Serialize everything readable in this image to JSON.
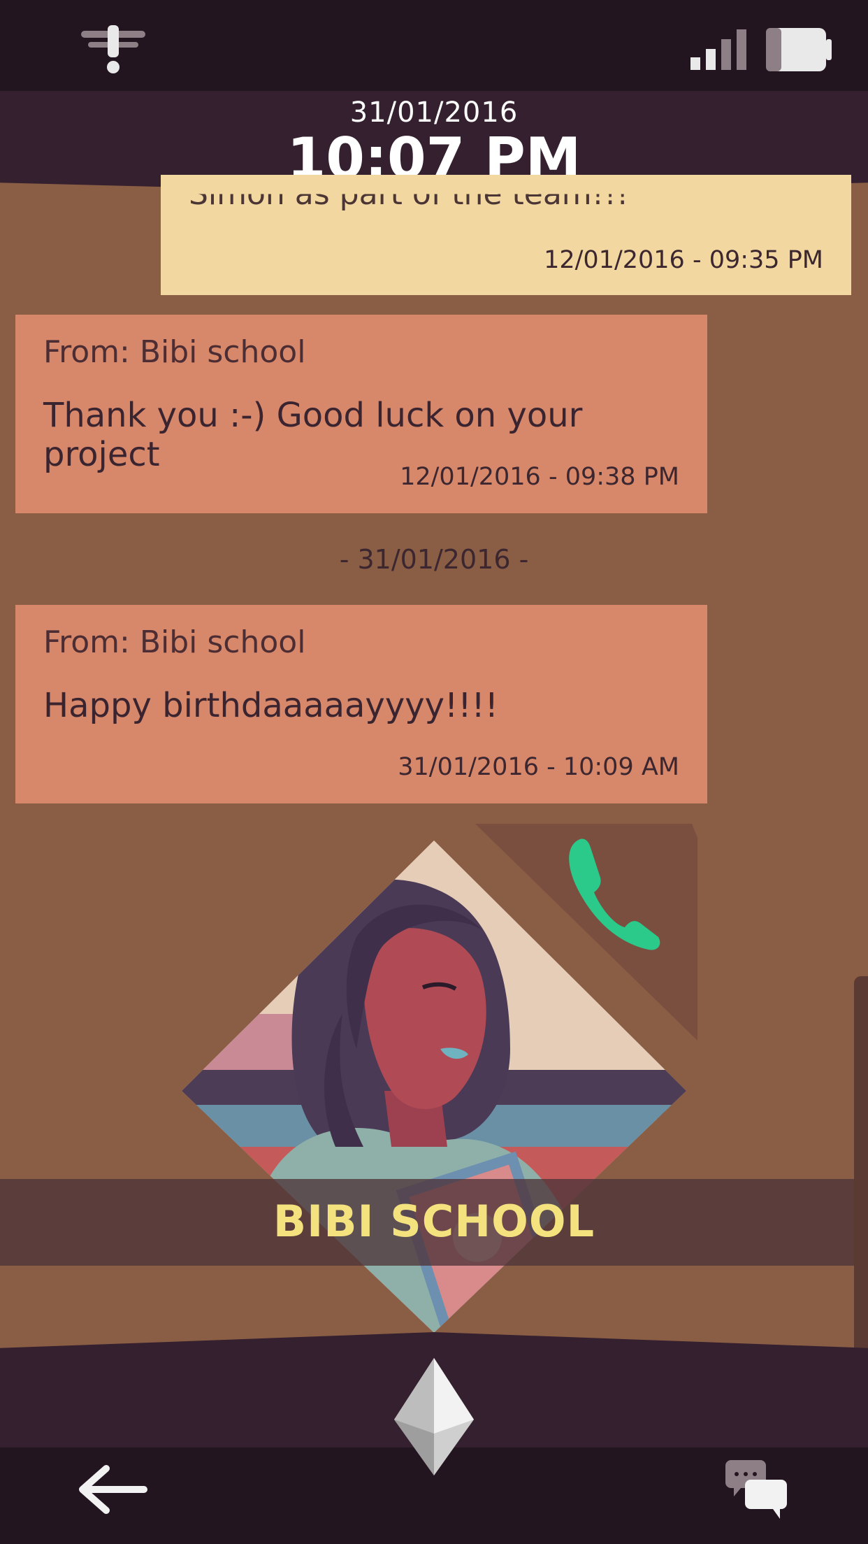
{
  "header": {
    "date": "31/01/2016",
    "time": "10:07 PM"
  },
  "status": {
    "notification_icon": "exclamation-icon",
    "signal_icon": "signal-bars-icon",
    "battery_icon": "battery-icon"
  },
  "conversation": {
    "previous_message": {
      "text_partial": "Simon as part of the team!!!",
      "timestamp": "12/01/2016 - 09:35 PM"
    },
    "messages": [
      {
        "from": "From: Bibi school",
        "text": "Thank you :-) Good luck on your project",
        "timestamp": "12/01/2016 - 09:38 PM"
      },
      {
        "from": "From: Bibi school",
        "text": "Happy birthdaaaaayyyy!!!!",
        "timestamp": "31/01/2016 - 10:09 AM"
      }
    ],
    "day_separator": "- 31/01/2016 -"
  },
  "contact": {
    "name": "BIBI SCHOOL",
    "call_icon": "phone-icon"
  },
  "navigation": {
    "back_icon": "back-arrow-icon",
    "home_icon": "diamond-home-icon",
    "chat_icon": "chat-bubbles-icon"
  },
  "colors": {
    "background": "#8a5d45",
    "bar": "#231520",
    "band": "#35202f",
    "sent_bubble": "#f2d8a0",
    "received_bubble": "#d8886a",
    "name_accent": "#f4e27e",
    "call_green": "#2bc98a"
  }
}
